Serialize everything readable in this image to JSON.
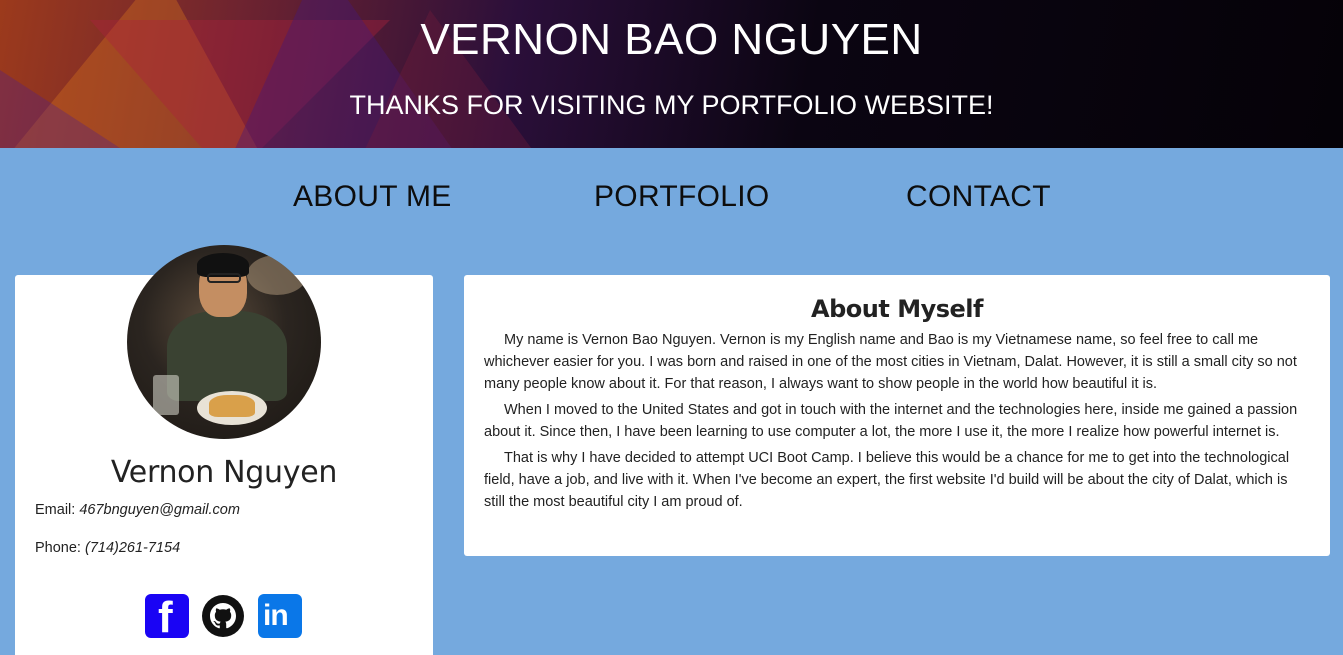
{
  "header": {
    "title": "VERNON BAO NGUYEN",
    "subtitle": "THANKS FOR VISITING MY PORTFOLIO WEBSITE!"
  },
  "nav": {
    "items": [
      {
        "label": "ABOUT ME"
      },
      {
        "label": "PORTFOLIO"
      },
      {
        "label": "CONTACT"
      }
    ]
  },
  "profile": {
    "name": "Vernon Nguyen",
    "email_label": "Email:",
    "email": "467bnguyen@gmail.com",
    "phone_label": "Phone:",
    "phone": "(714)261-7154",
    "social_icons": [
      "facebook-icon",
      "github-icon",
      "linkedin-icon"
    ]
  },
  "about": {
    "title": "About Myself",
    "paragraphs": [
      "My name is Vernon Bao Nguyen. Vernon is my English name and Bao is my Vietnamese name, so feel free to call me whichever easier for you. I was born and raised in one of the most cities in Vietnam, Dalat. However, it is still a small city so not many people know about it. For that reason, I always want to show people in the world how beautiful it is.",
      "When I moved to the United States and got in touch with the internet and the technologies here, inside me gained a passion about it. Since then, I have been learning to use computer a lot, the more I use it, the more I realize how powerful internet is.",
      "That is why I have decided to attempt UCI Boot Camp. I believe this would be a chance for me to get into the technological field, have a job, and live with it. When I've become an expert, the first website I'd build will be about the city of Dalat, which is still the most beautiful city I am proud of."
    ]
  },
  "colors": {
    "page_background": "#75a9de",
    "facebook": "#1a04f4",
    "linkedin": "#0a77e8"
  }
}
